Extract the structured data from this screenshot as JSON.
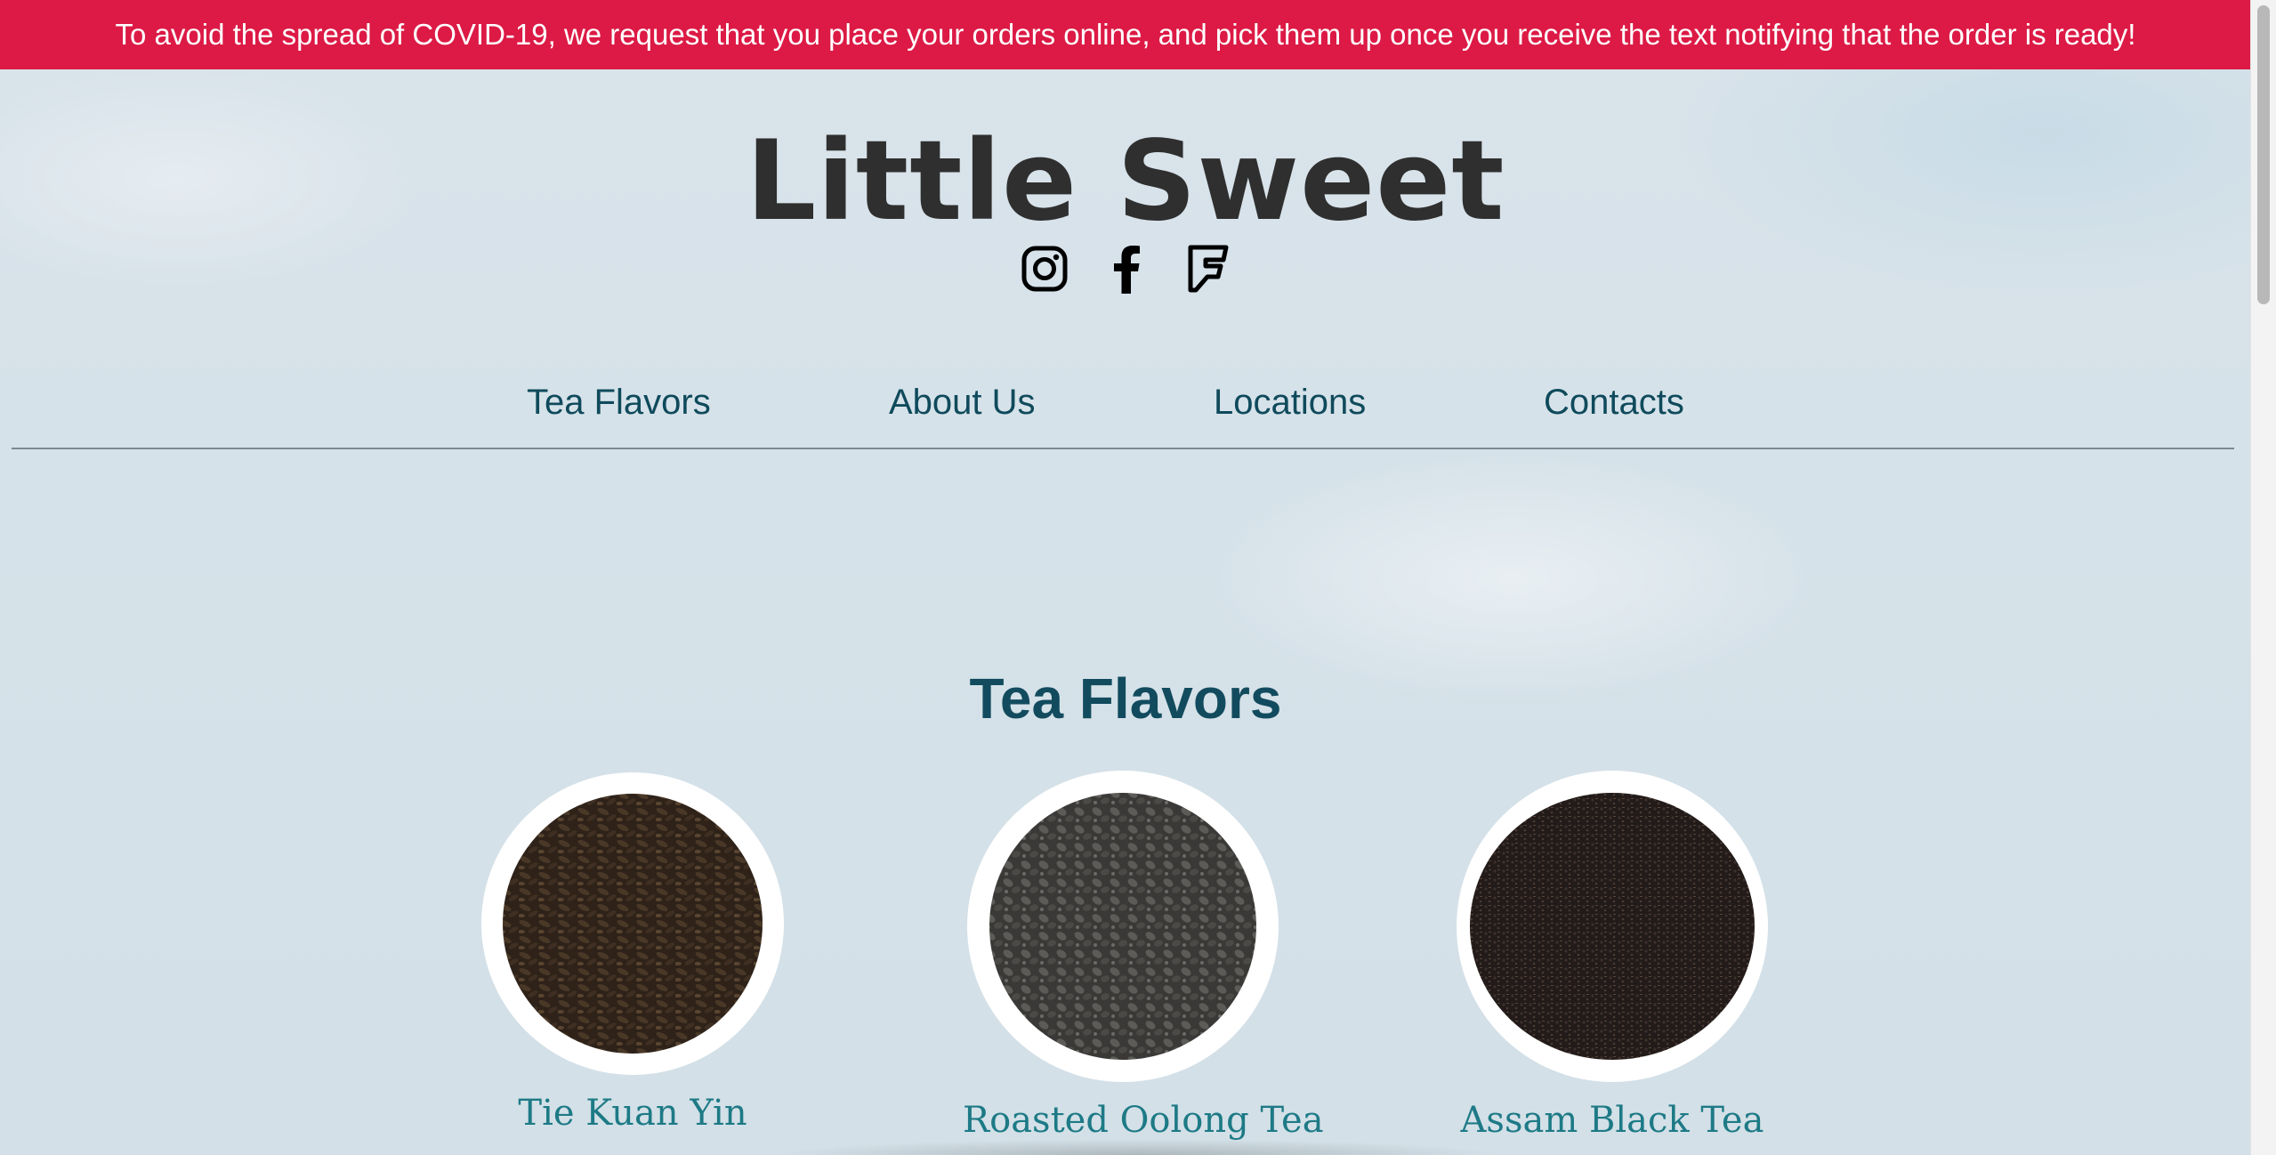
{
  "banner": {
    "text": "To avoid the spread of COVID-19, we request that you place your orders online, and pick them up once you receive the text notifying that the order is ready!"
  },
  "header": {
    "title": "Little Sweet",
    "social": [
      {
        "icon": "instagram-icon"
      },
      {
        "icon": "facebook-icon"
      },
      {
        "icon": "foursquare-icon"
      }
    ]
  },
  "nav": {
    "items": [
      {
        "label": "Tea Flavors"
      },
      {
        "label": "About Us"
      },
      {
        "label": "Locations"
      },
      {
        "label": "Contacts"
      }
    ]
  },
  "main": {
    "section_title": "Tea Flavors",
    "teas": [
      {
        "name": "Tie Kuan Yin",
        "leaf_color": "#3b2d22"
      },
      {
        "name": "Roasted Oolong Tea",
        "leaf_color": "#4a4947"
      },
      {
        "name": "Assam Black Tea",
        "leaf_color": "#2b2320"
      }
    ]
  },
  "colors": {
    "banner": "#dc1a45",
    "nav_text": "#0f4a5c",
    "section_title": "#124b5e",
    "tea_name": "#1d7a86"
  }
}
